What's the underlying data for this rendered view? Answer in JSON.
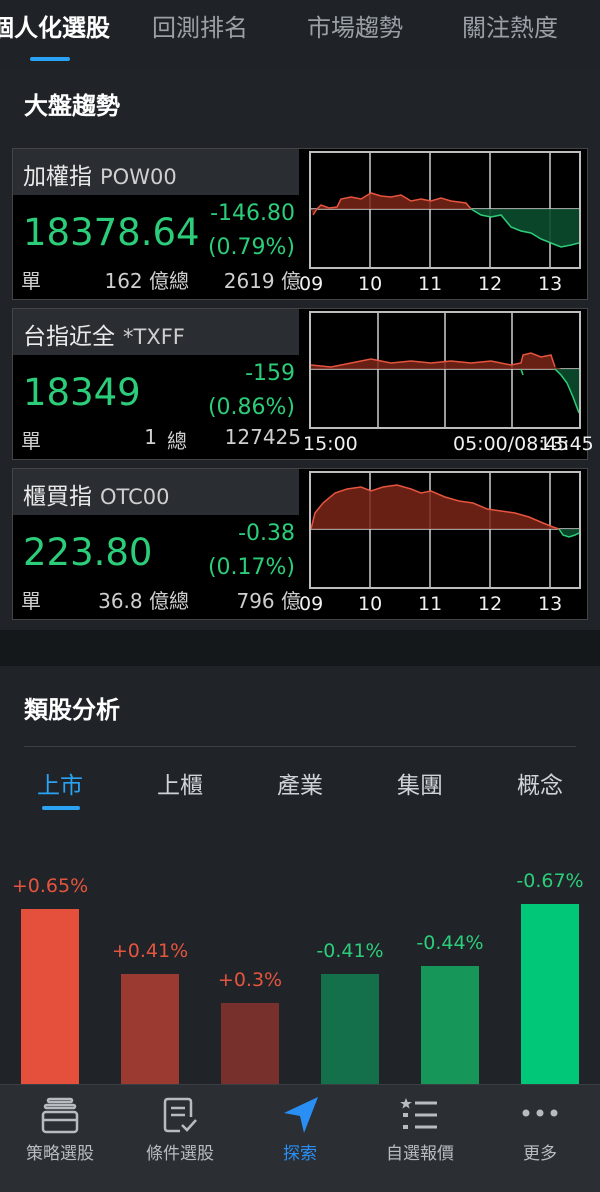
{
  "colors": {
    "up": "#e5543e",
    "down": "#2ccd7a",
    "accent": "#2aa3f4"
  },
  "top_tabs": [
    {
      "label": "個人化選股",
      "active": true
    },
    {
      "label": "回測排名",
      "active": false
    },
    {
      "label": "市場趨勢",
      "active": false
    },
    {
      "label": "關注熱度",
      "active": false
    }
  ],
  "market": {
    "title": "大盤趨勢",
    "cards": [
      {
        "name": "加權指",
        "code": "POW00",
        "price": "18378.64",
        "change": "-146.80",
        "pct": "(0.79%)",
        "single_label": "單",
        "single_value": "162 億",
        "total_label": "總",
        "total_value": "2619 億",
        "axis": [
          "09",
          "10",
          "11",
          "12",
          "13"
        ]
      },
      {
        "name": "台指近全",
        "code": "*TXFF",
        "price": "18349",
        "change": "-159",
        "pct": "(0.86%)",
        "single_label": "單",
        "single_value": "1",
        "total_label": "總",
        "total_value": "127425",
        "axis": [
          "15:00",
          "05:00/08:45",
          "13:45"
        ]
      },
      {
        "name": "櫃買指",
        "code": "OTC00",
        "price": "223.80",
        "change": "-0.38",
        "pct": "(0.17%)",
        "single_label": "單",
        "single_value": "36.8 億",
        "total_label": "總",
        "total_value": "796 億",
        "axis": [
          "09",
          "10",
          "11",
          "12",
          "13"
        ]
      }
    ]
  },
  "sector": {
    "title": "類股分析",
    "tabs": [
      {
        "label": "上市",
        "active": true
      },
      {
        "label": "上櫃",
        "active": false
      },
      {
        "label": "產業",
        "active": false
      },
      {
        "label": "集團",
        "active": false
      },
      {
        "label": "概念",
        "active": false
      }
    ],
    "bars": [
      {
        "label": "+0.65%",
        "value": 0.65
      },
      {
        "label": "+0.41%",
        "value": 0.41
      },
      {
        "label": "+0.3%",
        "value": 0.3
      },
      {
        "label": "-0.41%",
        "value": -0.41
      },
      {
        "label": "-0.44%",
        "value": -0.44
      },
      {
        "label": "-0.67%",
        "value": -0.67
      }
    ]
  },
  "bottom_nav": [
    {
      "label": "策略選股",
      "icon": "strategy-stack-icon",
      "active": false
    },
    {
      "label": "條件選股",
      "icon": "checklist-doc-icon",
      "active": false
    },
    {
      "label": "探索",
      "icon": "navigation-arrow-icon",
      "active": true
    },
    {
      "label": "自選報價",
      "icon": "starred-list-icon",
      "active": false
    },
    {
      "label": "更多",
      "icon": "more-dots-icon",
      "active": false
    }
  ]
}
